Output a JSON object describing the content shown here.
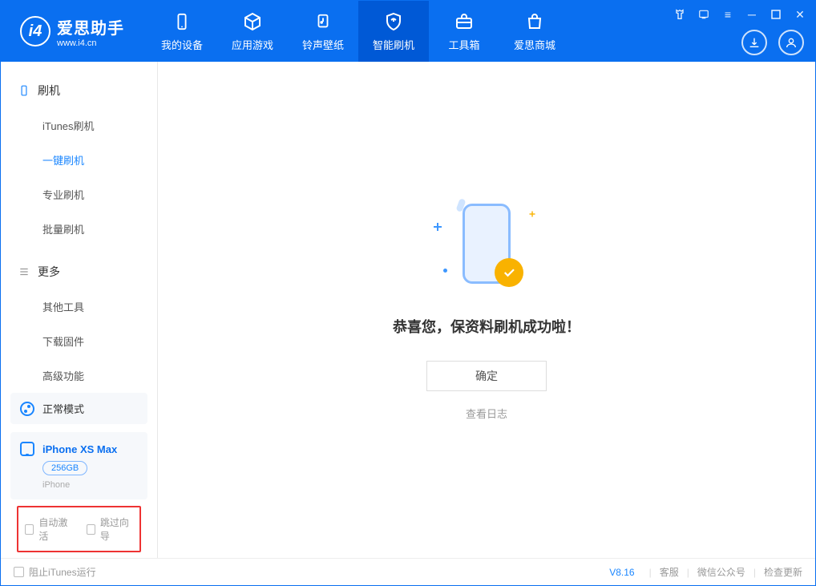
{
  "app": {
    "name": "爱思助手",
    "sub": "www.i4.cn"
  },
  "tabs": {
    "device": "我的设备",
    "apps": "应用游戏",
    "ring": "铃声壁纸",
    "flash": "智能刷机",
    "tools": "工具箱",
    "store": "爱思商城"
  },
  "sidebar": {
    "group1": "刷机",
    "items1": {
      "itunes": "iTunes刷机",
      "onekey": "一键刷机",
      "pro": "专业刷机",
      "batch": "批量刷机"
    },
    "group2": "更多",
    "items2": {
      "other": "其他工具",
      "fw": "下载固件",
      "adv": "高级功能"
    },
    "status": "正常模式",
    "device": {
      "name": "iPhone XS Max",
      "storage": "256GB",
      "type": "iPhone"
    },
    "opts": {
      "auto": "自动激活",
      "skip": "跳过向导"
    }
  },
  "main": {
    "message": "恭喜您，保资料刷机成功啦！",
    "ok": "确定",
    "log": "查看日志"
  },
  "footer": {
    "block": "阻止iTunes运行",
    "version": "V8.16",
    "service": "客服",
    "wechat": "微信公众号",
    "update": "检查更新"
  }
}
